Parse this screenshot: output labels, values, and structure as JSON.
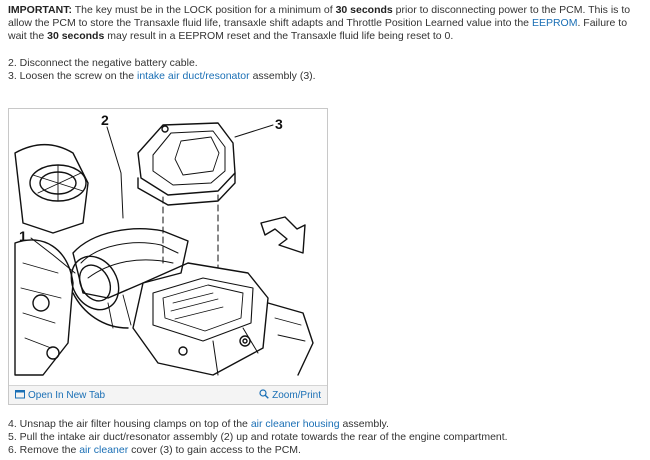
{
  "important": {
    "label": "IMPORTANT:",
    "t1": " The key must be in the LOCK position for a minimum of ",
    "b1": "30 seconds",
    "t2": " prior to disconnecting power to the PCM. This is to allow the PCM to store the Transaxle fluid life, transaxle shift adapts and Throttle Position Learned value into the ",
    "link": "EEPROM",
    "t3": ". Failure to wait the ",
    "b2": "30 seconds",
    "t4": " may result in a EEPROM reset and the Transaxle fluid life being reset to 0."
  },
  "steps_top": [
    {
      "pre": "2. Disconnect the negative battery cable.",
      "link": "",
      "post": ""
    },
    {
      "pre": "3. Loosen the screw on the ",
      "link": "intake air duct/resonator",
      "post": " assembly (3)."
    }
  ],
  "figure": {
    "callouts": [
      "1",
      "2",
      "3"
    ],
    "open_label": "Open In New Tab",
    "zoom_label": "Zoom/Print"
  },
  "steps_bottom": [
    {
      "pre": "4. Unsnap the air filter housing clamps on top of the ",
      "link": "air cleaner housing",
      "post": " assembly."
    },
    {
      "pre": "5. Pull the intake air duct/resonator assembly (2) up and rotate towards the rear of the engine compartment.",
      "link": "",
      "post": ""
    },
    {
      "pre": "6. Remove the ",
      "link": "air cleaner",
      "post": " cover (3) to gain access to the PCM."
    }
  ],
  "colors": {
    "link": "#1a6fb5",
    "text": "#333333"
  }
}
